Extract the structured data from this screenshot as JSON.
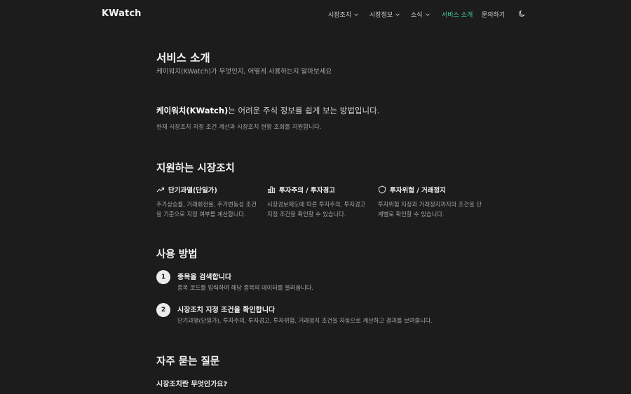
{
  "header": {
    "logo": "KWatch",
    "menu": [
      {
        "label": "시장조치"
      },
      {
        "label": "시장정보"
      },
      {
        "label": "소식"
      },
      {
        "label": "서비스 소개"
      },
      {
        "label": "문의하기"
      }
    ],
    "active_color": "#3ecf9a"
  },
  "hero": {
    "title": "서비스 소개",
    "subtitle": "케이워치(KWatch)가 무엇인지, 어떻게 사용하는지 알아보세요"
  },
  "intro": {
    "brand": "케이워치(KWatch)",
    "rest": "는 어려운 주식 정보를 쉽게 보는 방법입니다.",
    "sub": "현재 시장조치 지정 조건 계산과 시장조치 현황 조회를 지원합니다."
  },
  "features": {
    "heading": "지원하는 시장조치",
    "items": [
      {
        "title": "단기과열(단일가)",
        "icon": "trending-up-icon",
        "desc": "주가상승률, 거래회전율, 주가변동성 조건을 기준으로 지정 여부를 계산합니다."
      },
      {
        "title": "투자주의 / 투자경고",
        "icon": "bar-chart-icon",
        "desc": "시장경보제도에 따른 투자주의, 투자경고 지정 조건을 확인할 수 있습니다."
      },
      {
        "title": "투자위험 / 거래정지",
        "icon": "shield-icon",
        "desc": "투자위험 지정과 거래정지까지의 조건을 단계별로 확인할 수 있습니다."
      }
    ]
  },
  "usage": {
    "heading": "사용 방법",
    "steps": [
      {
        "num": "1",
        "title": "종목을 검색합니다",
        "desc": "종목 코드를 입력하여 해당 종목의 데이터를 불러옵니다."
      },
      {
        "num": "2",
        "title": "시장조치 지정 조건을 확인합니다",
        "desc": "단기과열(단일가), 투자주의, 투자경고, 투자위험, 거래정지 조건을 자동으로 계산하고 결과를 보여줍니다."
      }
    ]
  },
  "faq": {
    "heading": "자주 묻는 질문",
    "questions": [
      {
        "q": "시장조치란 무엇인가요?"
      }
    ]
  }
}
